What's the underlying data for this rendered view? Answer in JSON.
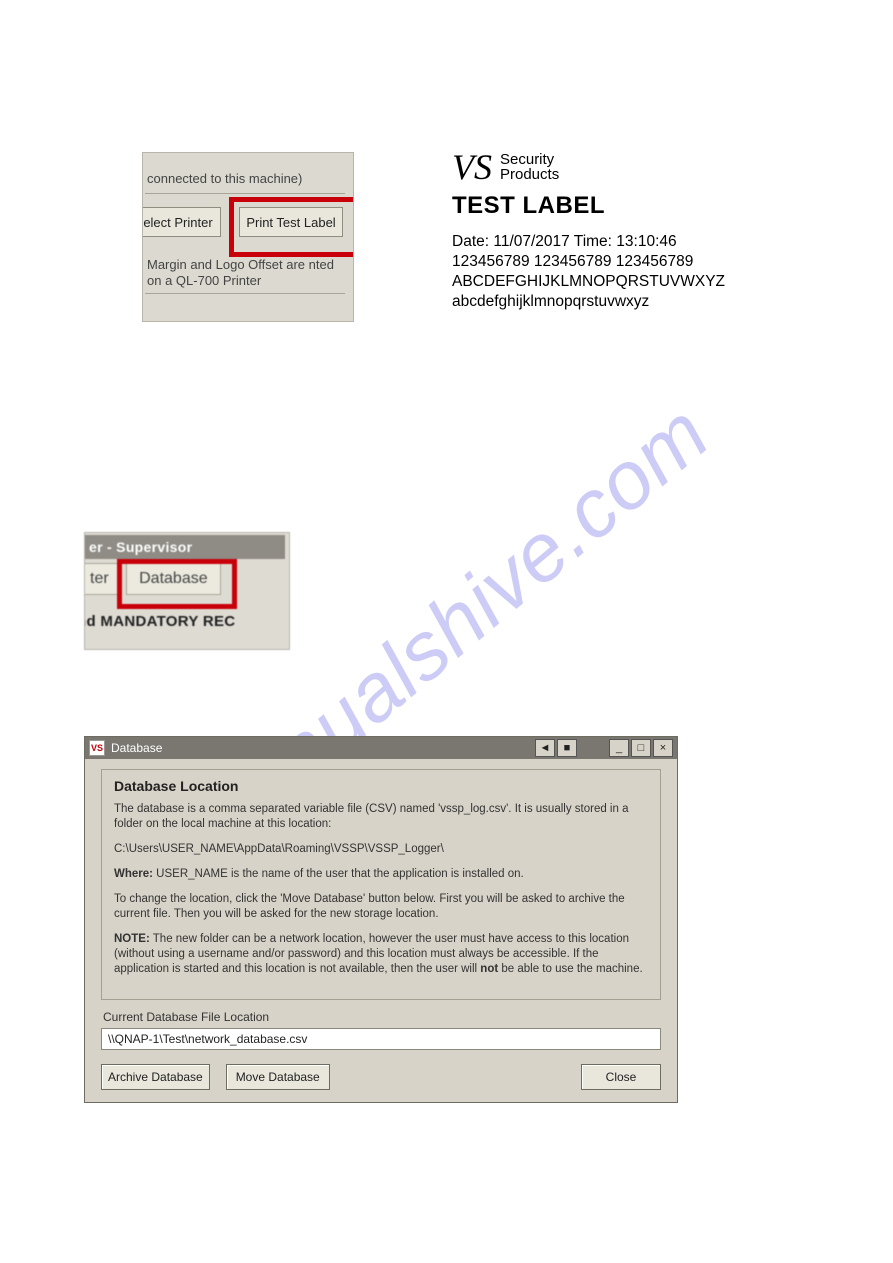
{
  "watermark_text": "manualshive.com",
  "shot1": {
    "hint_top": "connected to this machine)",
    "select_printer_btn": "elect Printer",
    "print_test_btn": "Print Test Label",
    "note_text": "Margin and Logo Offset are nted on a QL-700 Printer"
  },
  "test_label": {
    "logo_vs": "VS",
    "logo_line1": "Security",
    "logo_line2": "Products",
    "heading": "TEST LABEL",
    "date_line": "Date: 11/07/2017 Time: 13:10:46",
    "numbers_line": "123456789 123456789 123456789",
    "upper_line": "ABCDEFGHIJKLMNOPQRSTUVWXYZ",
    "lower_line": "abcdefghijklmnopqrstuvwxyz"
  },
  "shot2": {
    "titlebar": "er - Supervisor",
    "tab_left": "ter",
    "tab_db": "Database",
    "below_text": "nd MANDATORY REC"
  },
  "dialog": {
    "app_icon_text": "VS",
    "title": "Database",
    "min_glyph": "_",
    "max_glyph": "□",
    "close_glyph": "×",
    "extra_btn1": "◄",
    "extra_btn2": "■",
    "section_heading": "Database Location",
    "p1": "The database is a comma separated variable file (CSV) named 'vssp_log.csv'. It is usually stored in a folder on the local machine at this location:",
    "p_path": "C:\\Users\\USER_NAME\\AppData\\Roaming\\VSSP\\VSSP_Logger\\",
    "p_where_label": "Where:",
    "p_where_rest": " USER_NAME is the name of the user that the application is installed on.",
    "p_change": "To change the location, click the 'Move Database' button below. First you will be asked to archive the current file. Then you will be asked for the new storage location.",
    "p_note_label": "NOTE:",
    "p_note_rest_a": "  The new folder can be a network location, however the user must have access to this location (without using a username and/or password) and this location must always be accessible. If the application is started and this location is not available, then the user will ",
    "p_note_bold": "not",
    "p_note_rest_b": " be able to use the machine.",
    "current_label": "Current Database File Location",
    "current_path": "\\\\QNAP-1\\Test\\network_database.csv",
    "btn_archive": "Archive Database",
    "btn_move": "Move Database",
    "btn_close": "Close"
  }
}
